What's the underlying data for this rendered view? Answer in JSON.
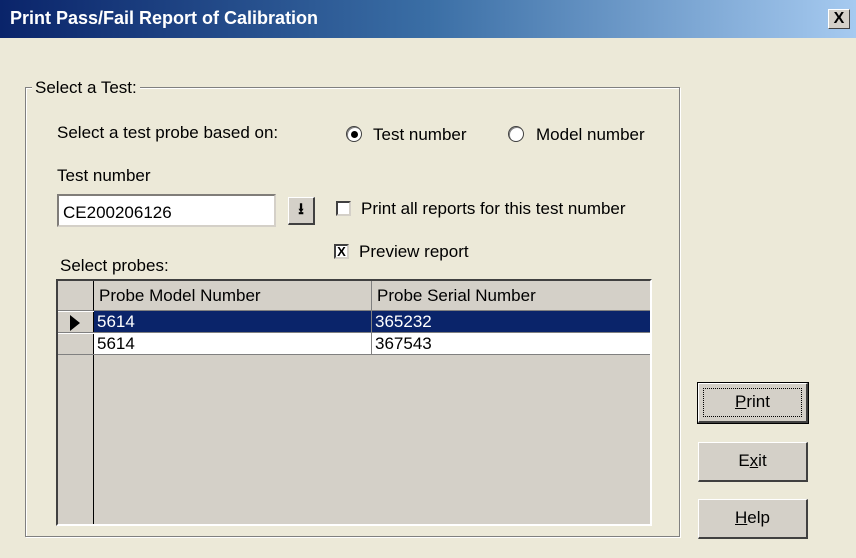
{
  "window": {
    "title": "Print Pass/Fail Report of Calibration",
    "close_label": "X"
  },
  "group": {
    "legend": "Select a Test:"
  },
  "selection_basis": {
    "label": "Select a test probe based on:",
    "options": [
      {
        "label": "Test number",
        "selected": true
      },
      {
        "label": "Model number",
        "selected": false
      }
    ]
  },
  "test_number": {
    "label": "Test number",
    "value": "CE200206126",
    "dropdown_icon": "down-arrow-icon"
  },
  "checkboxes": {
    "print_all": {
      "label": "Print all reports for this test number",
      "checked": false
    },
    "preview": {
      "label": "Preview report",
      "checked": true,
      "mark": "X"
    }
  },
  "probes": {
    "label": "Select probes:",
    "columns": [
      "Probe Model Number",
      "Probe Serial Number"
    ],
    "rows": [
      {
        "model": "5614",
        "serial": "365232",
        "selected": true
      },
      {
        "model": "5614",
        "serial": "367543",
        "selected": false
      }
    ]
  },
  "buttons": {
    "print": {
      "prefix": "",
      "accel": "P",
      "suffix": "rint"
    },
    "exit": {
      "prefix": "E",
      "accel": "x",
      "suffix": "it"
    },
    "help": {
      "prefix": "",
      "accel": "H",
      "suffix": "elp"
    }
  }
}
